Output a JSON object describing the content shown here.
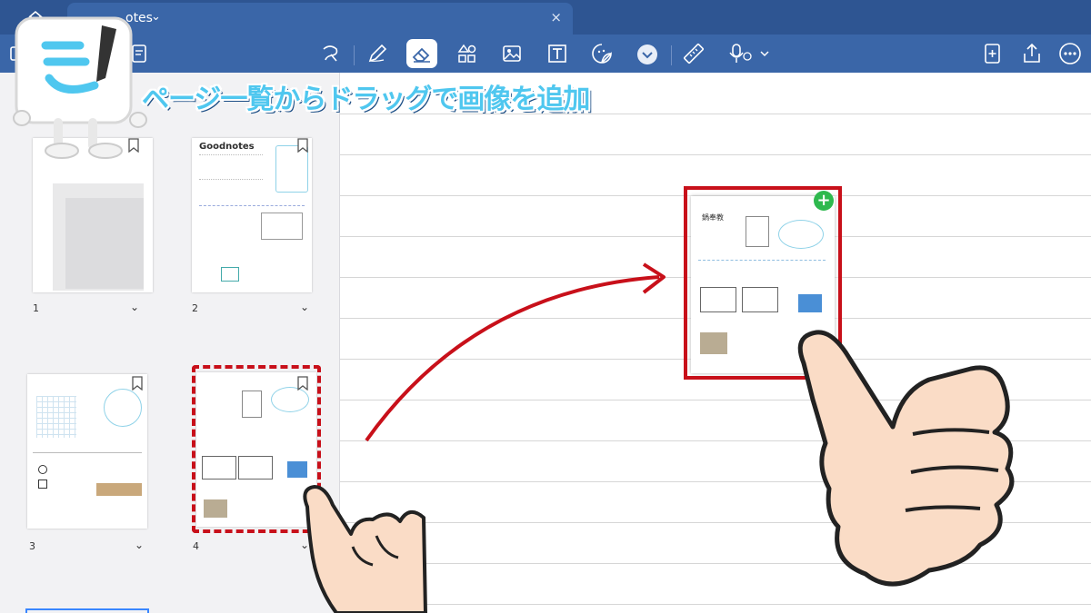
{
  "tabbar": {
    "tab_title": "otes",
    "close": "×",
    "chevron": "⌄"
  },
  "overlay": {
    "title": "ページ一覧からドラッグで画像を追加"
  },
  "thumbnails": [
    {
      "num": "1",
      "title": ""
    },
    {
      "num": "2",
      "title": "Goodnotes"
    },
    {
      "num": "3",
      "title": ""
    },
    {
      "num": "4",
      "title": ""
    }
  ],
  "page_preview": {
    "heading": "鍋奉教"
  },
  "plus": "+",
  "colors": {
    "toolbar": "#3a66a8",
    "tabbar": "#2e5592",
    "accent_red": "#c8101a",
    "title_blue": "#4fc7ef",
    "plus_green": "#2eb94e"
  },
  "icons": [
    "home-icon",
    "lasso-icon",
    "pen-icon",
    "eraser-icon",
    "shapes-icon",
    "image-icon",
    "textbox-icon",
    "sticker-icon",
    "more-tools-icon",
    "ruler-icon",
    "mic-icon",
    "add-page-icon",
    "share-icon",
    "ellipsis-icon",
    "bookmark-icon",
    "chevron-down-icon"
  ]
}
